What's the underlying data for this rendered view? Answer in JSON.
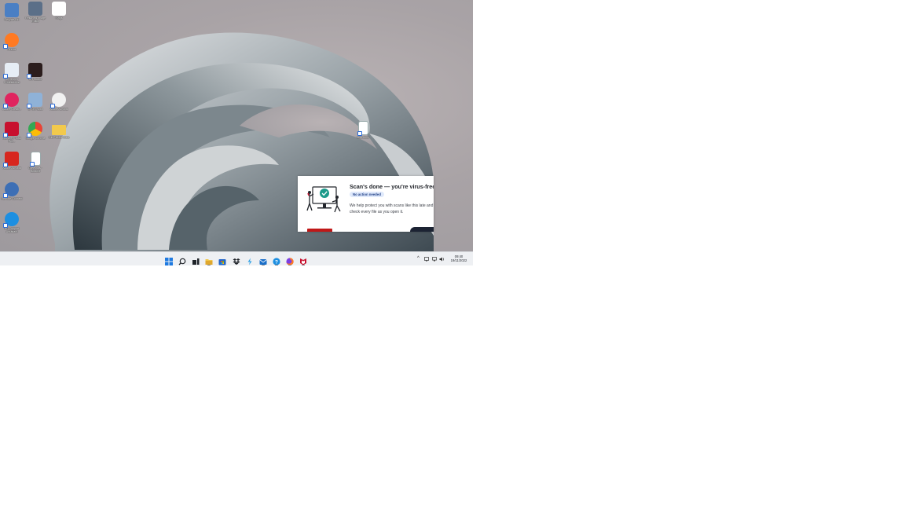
{
  "desktop": {
    "icons": [
      {
        "id": "recycle-bin",
        "label": "Recycle Bin",
        "color": "#4a7fc4",
        "icon": "recycle-bin-icon"
      },
      {
        "id": "snipping",
        "label": "Resolved Image Editor",
        "color": "#5b6f88",
        "icon": "screenshot-editor-icon"
      },
      {
        "id": "kings",
        "label": "Kings",
        "color": "#ffffff",
        "icon": "k-logo-icon"
      },
      {
        "id": "firefox",
        "label": "Firefox",
        "color": "#ff7a22",
        "icon": "firefox-icon"
      },
      {
        "id": "iccleaner",
        "label": "iCCleaner Professional",
        "color": "#e6edf5",
        "icon": "cleaner-icon"
      },
      {
        "id": "kh",
        "label": "KH Studio",
        "color": "#2b1d1d",
        "icon": "kh-logo-icon"
      },
      {
        "id": "adobe-cloud",
        "label": "Adobe Creati...",
        "color": "#e0245e",
        "icon": "creative-cloud-icon"
      },
      {
        "id": "scanner",
        "label": "CPOS Scan",
        "color": "#8fb2d8",
        "icon": "scanner-icon"
      },
      {
        "id": "acrobat-assist",
        "label": "Adobe Acrobat",
        "color": "#f1f1f1",
        "icon": "acrobat-assistant-icon"
      },
      {
        "id": "mcafee",
        "label": "McAfee® Total Pro...",
        "color": "#c8102e",
        "icon": "mcafee-icon"
      },
      {
        "id": "chrome",
        "label": "Google Chrome",
        "color": "#ffffff",
        "icon": "chrome-icon"
      },
      {
        "id": "folder",
        "label": "Old Firefox Data",
        "color": "#f2c94c",
        "icon": "folder-icon"
      },
      {
        "id": "acrobat",
        "label": "Adobe Acrobat",
        "color": "#d7261e",
        "icon": "acrobat-icon"
      },
      {
        "id": "pdf-doc",
        "label": "Greetings - Booklet",
        "color": "#ffffff",
        "icon": "pdf-file-icon"
      },
      {
        "id": "globe",
        "label": "Remote Connect",
        "color": "#3d6fb5",
        "icon": "globe-icon"
      },
      {
        "id": "hp-support",
        "label": "HP Support Assistant",
        "color": "#1d8fe1",
        "icon": "help-icon"
      },
      {
        "id": "doc-file",
        "label": "xxxx.docx",
        "color": "#ffffff",
        "icon": "document-file-icon"
      }
    ]
  },
  "toast": {
    "title": "Scan's done — you're virus-free",
    "badge": "No action needed",
    "body": "We help protect you with scans like this late and we check every file as you open it.",
    "accent": "#1d9a8a"
  },
  "taskbar": {
    "apps": [
      {
        "id": "start",
        "icon": "windows-start-icon",
        "color": "#1f7ae0"
      },
      {
        "id": "search",
        "icon": "search-icon",
        "color": "#1f2329"
      },
      {
        "id": "taskview",
        "icon": "task-view-icon",
        "color": "#1f2329"
      },
      {
        "id": "explorer",
        "icon": "file-explorer-icon",
        "color": "#f2c94c"
      },
      {
        "id": "store",
        "icon": "store-icon",
        "color": "#2465c8"
      },
      {
        "id": "dropbox",
        "icon": "dropbox-icon",
        "color": "#1f2329"
      },
      {
        "id": "bolt",
        "icon": "bolt-icon",
        "color": "#2ea1e6"
      },
      {
        "id": "mail",
        "icon": "mail-icon",
        "color": "#1a6fc9"
      },
      {
        "id": "help",
        "icon": "help-icon",
        "color": "#1d8fe1"
      },
      {
        "id": "firefox",
        "icon": "firefox-icon",
        "color": "#ff7a22"
      },
      {
        "id": "mcafee",
        "icon": "mcafee-icon",
        "color": "#c8102e"
      }
    ],
    "tray": {
      "chevron": "^",
      "clock_time": "09:40",
      "clock_date": "19/11/2022"
    }
  }
}
